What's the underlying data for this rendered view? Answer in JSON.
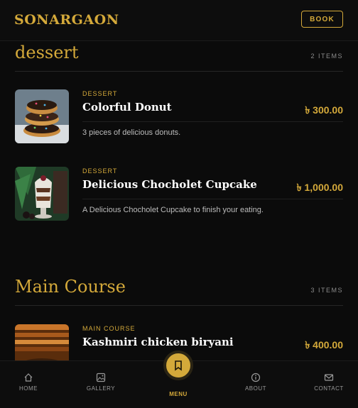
{
  "header": {
    "brand": "SONARGAON",
    "book_label": "BOOK"
  },
  "sections": [
    {
      "title": "dessert",
      "count": "2 ITEMS",
      "items": [
        {
          "category": "DESSERT",
          "name": "Colorful Donut",
          "price": "৳ 300.00",
          "description": "3 pieces of delicious donuts."
        },
        {
          "category": "DESSERT",
          "name": "Delicious Chocholet Cupcake",
          "price": "৳ 1,000.00",
          "description": "A Delicious Chocholet Cupcake to finish your eating."
        }
      ]
    },
    {
      "title": "Main Course",
      "count": "3 ITEMS",
      "items": [
        {
          "category": "MAIN COURSE",
          "name": "Kashmiri chicken biryani",
          "price": "৳ 400.00"
        }
      ]
    }
  ],
  "nav": {
    "home": "HOME",
    "gallery": "GALLERY",
    "menu": "MENU",
    "about": "ABOUT",
    "contact": "CONTACT"
  },
  "colors": {
    "accent": "#d4a93a",
    "background": "#0b0b0b"
  },
  "icons": [
    "home-icon",
    "gallery-icon",
    "menu-icon",
    "info-icon",
    "mail-icon"
  ]
}
